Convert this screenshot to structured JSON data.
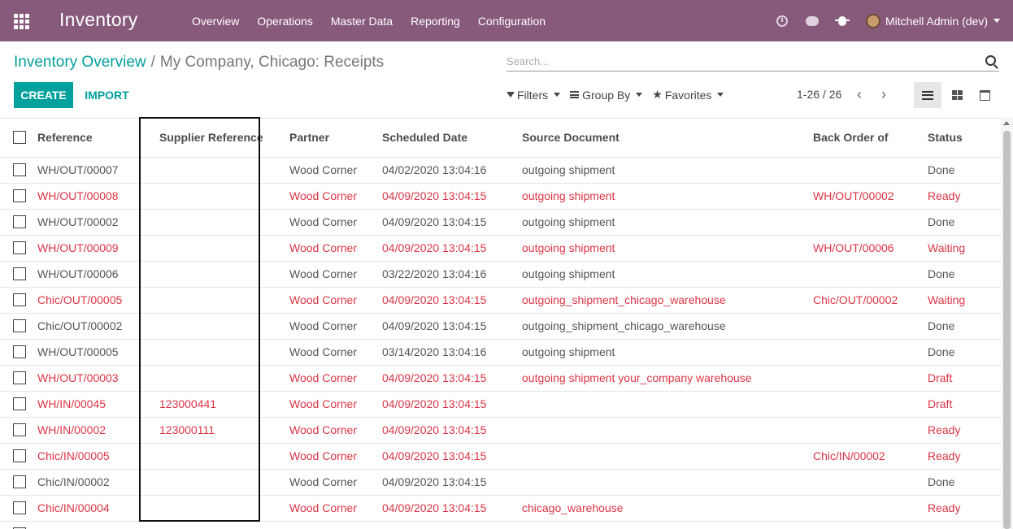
{
  "navbar": {
    "app_title": "Inventory",
    "menu": [
      "Overview",
      "Operations",
      "Master Data",
      "Reporting",
      "Configuration"
    ],
    "user_name": "Mitchell Admin (dev)",
    "icons": [
      "apps-grid-icon",
      "clock-icon",
      "chat-icon",
      "bug-icon"
    ],
    "bg_color": "#875a7b"
  },
  "breadcrumb": {
    "parent": "Inventory Overview",
    "separator": "/",
    "current": "My Company, Chicago: Receipts"
  },
  "search": {
    "placeholder": "Search..."
  },
  "buttons": {
    "create": "CREATE",
    "import": "IMPORT",
    "accent_color": "#00a09d"
  },
  "filters": {
    "filters": "Filters",
    "group_by": "Group By",
    "favorites": "Favorites"
  },
  "pager": {
    "range": "1-26 / 26"
  },
  "table": {
    "columns": [
      "Reference",
      "Supplier Reference",
      "Partner",
      "Scheduled Date",
      "Source Document",
      "Back Order of",
      "Status"
    ],
    "rows": [
      {
        "ref": "WH/OUT/00007",
        "supplier": "",
        "partner": "Wood Corner",
        "date": "04/02/2020 13:04:16",
        "source": "outgoing shipment",
        "backorder": "",
        "status": "Done",
        "late": false
      },
      {
        "ref": "WH/OUT/00008",
        "supplier": "",
        "partner": "Wood Corner",
        "date": "04/09/2020 13:04:15",
        "source": "outgoing shipment",
        "backorder": "WH/OUT/00002",
        "status": "Ready",
        "late": true
      },
      {
        "ref": "WH/OUT/00002",
        "supplier": "",
        "partner": "Wood Corner",
        "date": "04/09/2020 13:04:15",
        "source": "outgoing shipment",
        "backorder": "",
        "status": "Done",
        "late": false
      },
      {
        "ref": "WH/OUT/00009",
        "supplier": "",
        "partner": "Wood Corner",
        "date": "04/09/2020 13:04:15",
        "source": "outgoing shipment",
        "backorder": "WH/OUT/00006",
        "status": "Waiting",
        "late": true
      },
      {
        "ref": "WH/OUT/00006",
        "supplier": "",
        "partner": "Wood Corner",
        "date": "03/22/2020 13:04:16",
        "source": "outgoing shipment",
        "backorder": "",
        "status": "Done",
        "late": false
      },
      {
        "ref": "Chic/OUT/00005",
        "supplier": "",
        "partner": "Wood Corner",
        "date": "04/09/2020 13:04:15",
        "source": "outgoing_shipment_chicago_warehouse",
        "backorder": "Chic/OUT/00002",
        "status": "Waiting",
        "late": true
      },
      {
        "ref": "Chic/OUT/00002",
        "supplier": "",
        "partner": "Wood Corner",
        "date": "04/09/2020 13:04:15",
        "source": "outgoing_shipment_chicago_warehouse",
        "backorder": "",
        "status": "Done",
        "late": false
      },
      {
        "ref": "WH/OUT/00005",
        "supplier": "",
        "partner": "Wood Corner",
        "date": "03/14/2020 13:04:16",
        "source": "outgoing shipment",
        "backorder": "",
        "status": "Done",
        "late": false
      },
      {
        "ref": "WH/OUT/00003",
        "supplier": "",
        "partner": "Wood Corner",
        "date": "04/09/2020 13:04:15",
        "source": "outgoing shipment your_company warehouse",
        "backorder": "",
        "status": "Draft",
        "late": true
      },
      {
        "ref": "WH/IN/00045",
        "supplier": "123000441",
        "partner": "Wood Corner",
        "date": "04/09/2020 13:04:15",
        "source": "",
        "backorder": "",
        "status": "Draft",
        "late": true
      },
      {
        "ref": "WH/IN/00002",
        "supplier": "123000111",
        "partner": "Wood Corner",
        "date": "04/09/2020 13:04:15",
        "source": "",
        "backorder": "",
        "status": "Ready",
        "late": true
      },
      {
        "ref": "Chic/IN/00005",
        "supplier": "",
        "partner": "Wood Corner",
        "date": "04/09/2020 13:04:15",
        "source": "",
        "backorder": "Chic/IN/00002",
        "status": "Ready",
        "late": true
      },
      {
        "ref": "Chic/IN/00002",
        "supplier": "",
        "partner": "Wood Corner",
        "date": "04/09/2020 13:04:15",
        "source": "",
        "backorder": "",
        "status": "Done",
        "late": false
      },
      {
        "ref": "Chic/IN/00004",
        "supplier": "",
        "partner": "Wood Corner",
        "date": "04/09/2020 13:04:15",
        "source": "chicago_warehouse",
        "backorder": "",
        "status": "Ready",
        "late": true
      },
      {
        "ref": "",
        "supplier": "",
        "partner": "",
        "date": "",
        "source": "",
        "backorder": "",
        "status": "",
        "late": false
      }
    ],
    "late_color": "#dc3545"
  }
}
